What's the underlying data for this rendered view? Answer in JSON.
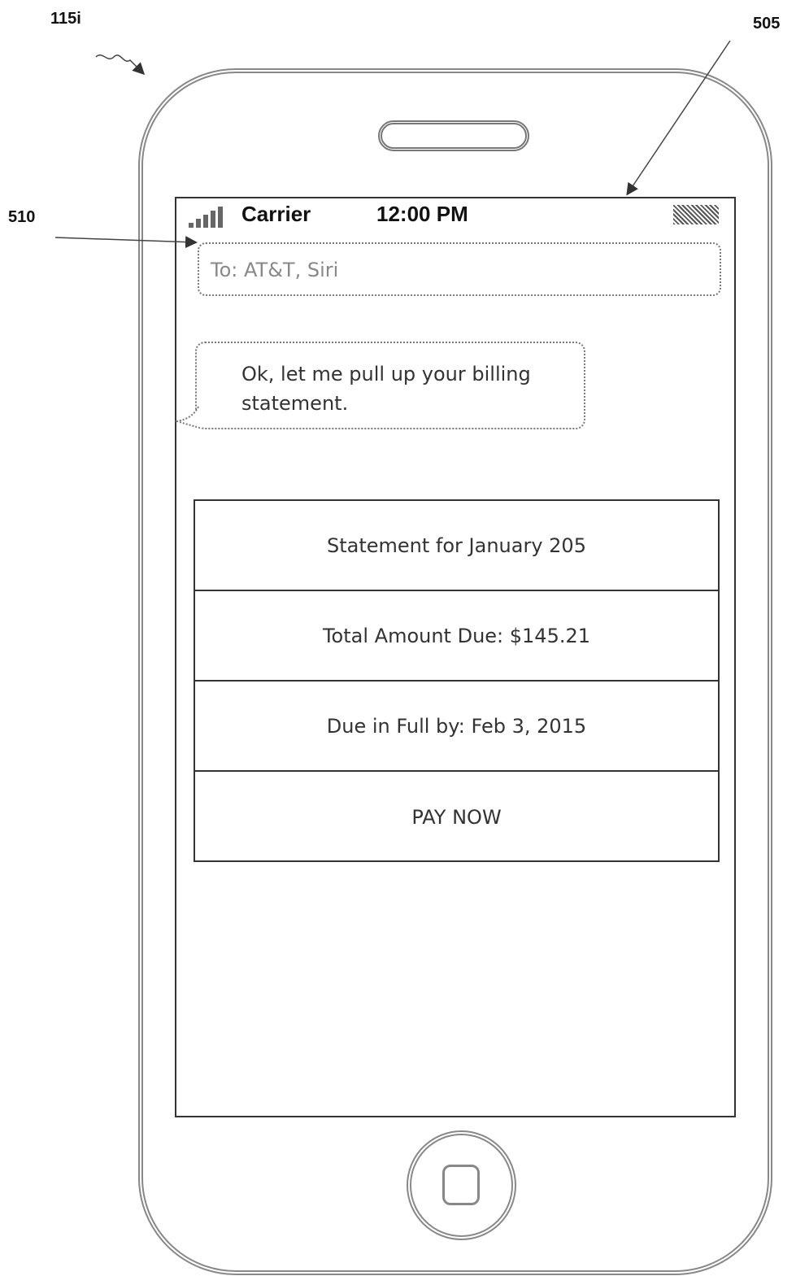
{
  "references": {
    "device": "115i",
    "screen": "505",
    "recipient_field": "510"
  },
  "status_bar": {
    "carrier": "Carrier",
    "time": "12:00 PM"
  },
  "recipient_field": {
    "text": "To: AT&T, Siri"
  },
  "message_bubble": {
    "text": "Ok, let me pull up your billing statement."
  },
  "statement": {
    "title": "Statement for January 205",
    "total_due": "Total Amount Due: $145.21",
    "due_date": "Due in Full by: Feb 3, 2015",
    "pay_button": "PAY NOW"
  },
  "icons": [
    "signal-icon",
    "battery-icon",
    "speaker-grille-icon",
    "home-button-icon"
  ]
}
